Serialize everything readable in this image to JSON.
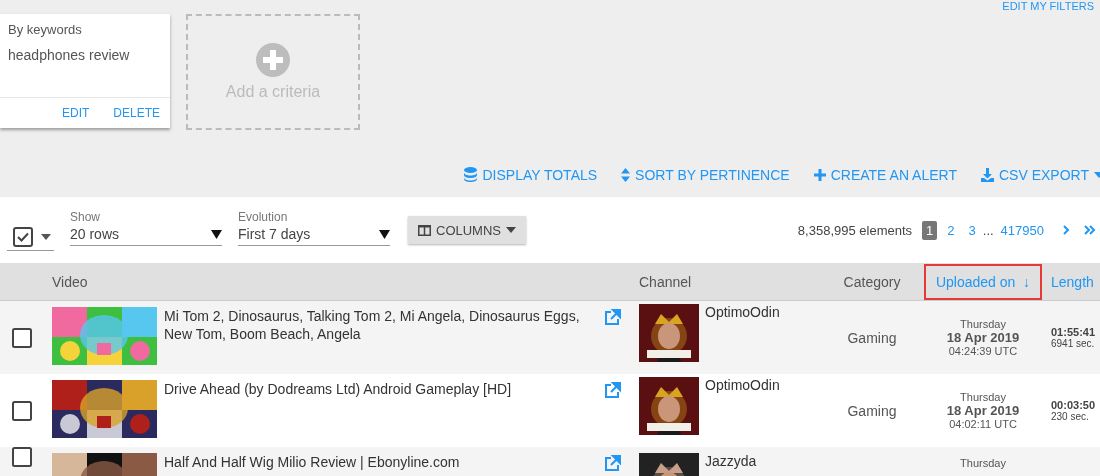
{
  "filters": {
    "edit_link": "EDIT MY FILTERS",
    "criteria": [
      {
        "label": "By keywords",
        "value": "headphones review",
        "actions": [
          "EDIT",
          "DELETE"
        ]
      }
    ],
    "add_label": "Add a criteria"
  },
  "actions": [
    {
      "label": "DISPLAY TOTALS"
    },
    {
      "label": "SORT BY PERTINENCE"
    },
    {
      "label": "CREATE AN ALERT"
    },
    {
      "label": "CSV EXPORT"
    }
  ],
  "toolbar": {
    "select_all": {
      "checked": true
    },
    "selects": [
      {
        "label": "Show",
        "value": "20 rows"
      },
      {
        "label": "Evolution",
        "value": "First 7 days"
      }
    ],
    "columns_button": "COLUMNS",
    "count": "8,358,995 elements",
    "pages": [
      {
        "label": "1",
        "selected": true
      },
      {
        "label": "2",
        "selected": false
      },
      {
        "label": "3",
        "selected": false
      },
      {
        "label": "...",
        "kind": "gap"
      },
      {
        "label": "417950",
        "selected": false
      }
    ]
  },
  "table": {
    "columns": [
      {
        "label": "Video",
        "highlighted": false
      },
      {
        "label": "Channel",
        "highlighted": false
      },
      {
        "label": "Category",
        "highlighted": false
      },
      {
        "label": "Uploaded on",
        "sort_arrow": "↓",
        "highlighted": true
      },
      {
        "label": "Length",
        "highlighted": false
      }
    ],
    "rows": [
      {
        "checked": false,
        "title": "Mi Tom 2, Dinosaurus, Talking Tom 2, Mi Angela, Dinosaurus Eggs, New Tom, Boom Beach, Angela",
        "channel": "OptimoOdin",
        "category": "Gaming",
        "day": "Thursday",
        "date": "18 Apr 2019",
        "time": "04:24:39 UTC",
        "duration": "01:55:41",
        "seconds": "6941 sec."
      },
      {
        "checked": false,
        "title": "Drive Ahead (by Dodreams Ltd) Android Gameplay [HD]",
        "channel": "OptimoOdin",
        "category": "Gaming",
        "day": "Thursday",
        "date": "18 Apr 2019",
        "time": "04:02:11 UTC",
        "duration": "00:03:50",
        "seconds": "230 sec."
      },
      {
        "checked": false,
        "title": "Half And Half Wig Milio Review | Ebonyline.com",
        "channel": "Jazzyda",
        "day": "Thursday"
      }
    ]
  }
}
